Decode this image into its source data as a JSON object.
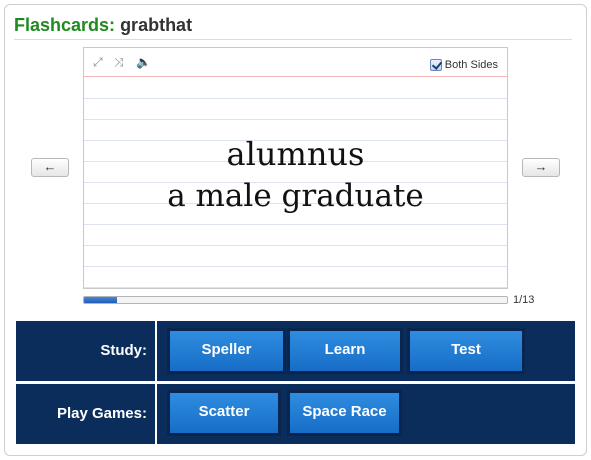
{
  "header": {
    "label": "Flashcards:",
    "set_name": "grabthat"
  },
  "toolbar": {
    "expand_icon": "⤢",
    "shuffle_icon": "⤨",
    "sound_icon": "🔈",
    "both_sides_label": "Both Sides",
    "both_sides_checked": true
  },
  "card": {
    "term": "alumnus",
    "definition": "a male graduate"
  },
  "nav": {
    "prev_label": "←",
    "next_label": "→"
  },
  "progress": {
    "current": 1,
    "total": 13,
    "fraction": 0.077,
    "count_text": "1/13"
  },
  "study": {
    "label": "Study:",
    "buttons": [
      "Speller",
      "Learn",
      "Test"
    ]
  },
  "games": {
    "label": "Play Games:",
    "buttons": [
      "Scatter",
      "Space Race"
    ]
  },
  "colors": {
    "header_label": "#1f8a1f",
    "row_background": "#0b2d5c",
    "button_blue": "#2f8de0",
    "progress_fill": "#1f5fb8"
  }
}
